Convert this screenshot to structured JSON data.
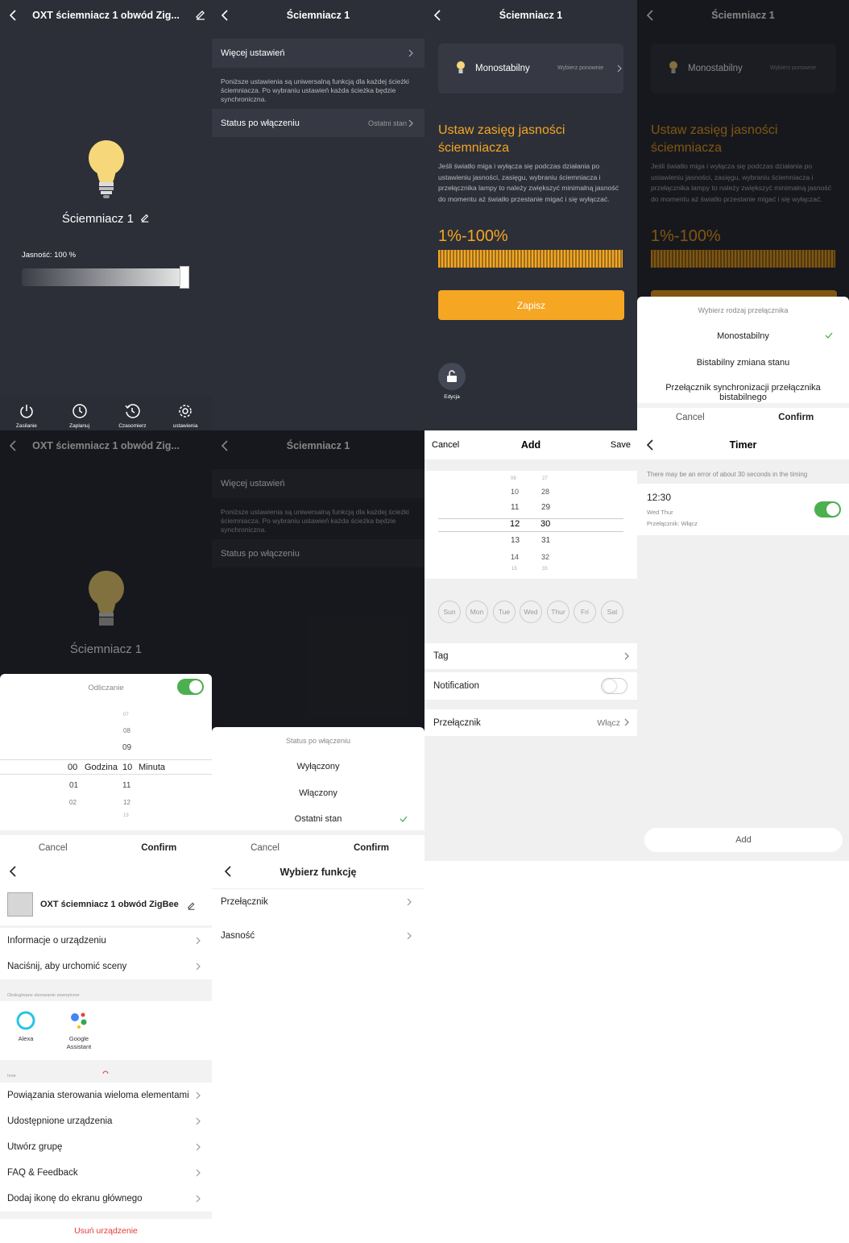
{
  "colors": {
    "dark_bg": "#2c2f38",
    "accent": "#f5a623",
    "green": "#4caf50",
    "red": "#e53935"
  },
  "p1": {
    "title": "OXT ściemniacz 1 obwód Zig...",
    "device_name": "Ściemniacz 1",
    "brightness_label": "Jasność: 100 %",
    "brightness": 1.0,
    "nav": [
      "Zasilanie",
      "Zaplanuj",
      "Czasomierz",
      "ustawienia"
    ]
  },
  "p2": {
    "title": "Ściemniacz 1",
    "more_settings": "Więcej ustawień",
    "desc": "Poniższe ustawienia są uniwersalną funkcją dla każdej ścieżki ściemniacza. Po wybraniu ustawień każda ścieżka będzie synchroniczna.",
    "status_label": "Status po włączeniu",
    "status_value": "Ostatni stan"
  },
  "p3": {
    "title": "Ściemniacz 1",
    "switch_type": "Monostabilny",
    "rechoose": "Wybierz ponownie",
    "heading": "Ustaw zasięg jasności ściemniacza",
    "body": "Jeśli światło miga i wyłącza się podczas działania po ustawieniu jasności, zasięgu, wybraniu ściemniacza i przełącznika lampy to należy zwiększyć minimalną jasność do momentu aż światło przestanie migać i się wyłączać.",
    "range": "1%-100%",
    "save": "Zapisz",
    "edit": "Edycja"
  },
  "p4": {
    "sheet_title": "Wybierz rodzaj przełącznika",
    "options": [
      "Monostabilny",
      "Bistabilny zmiana stanu",
      "Przełącznik synchronizacji przełącznika bistabilnego"
    ],
    "cancel": "Cancel",
    "confirm": "Confirm"
  },
  "p5": {
    "countdown": "Odliczanie",
    "hours": [
      "",
      "",
      "",
      "00",
      "01",
      "02",
      ""
    ],
    "minutes": [
      "07",
      "08",
      "09",
      "10",
      "11",
      "12",
      "13"
    ],
    "hour_unit": "Godzina",
    "minute_unit": "Minuta",
    "cancel": "Cancel",
    "confirm": "Confirm"
  },
  "p6": {
    "sheet_title": "Status po włączeniu",
    "options": [
      "Wyłączony",
      "Włączony",
      "Ostatni stan"
    ],
    "cancel": "Cancel",
    "confirm": "Confirm"
  },
  "p7": {
    "cancel": "Cancel",
    "title": "Add",
    "save": "Save",
    "hours": [
      "09",
      "10",
      "11",
      "12",
      "13",
      "14",
      "15"
    ],
    "minutes": [
      "27",
      "28",
      "29",
      "30",
      "31",
      "32",
      "33"
    ],
    "days": [
      "Sun",
      "Mon",
      "Tue",
      "Wed",
      "Thur",
      "Fri",
      "Sat"
    ],
    "tag": "Tag",
    "notification": "Notification",
    "switch_label": "Przełącznik",
    "switch_value": "Włącz"
  },
  "p8": {
    "title": "Timer",
    "note": "There may be an error of about 30 seconds in the timing",
    "time": "12:30",
    "days": "Wed Thur",
    "action": "Przełącznik: Włącz",
    "add": "Add"
  },
  "p9": {
    "device": "OXT ściemniacz 1 obwód ZigBee",
    "info": "Informacje o urządzeniu",
    "scene": "Naciśnij, aby urchomić sceny",
    "ext_label": "Obsługiwane sterowanie zewnętrzne",
    "alexa": "Alexa",
    "google": "Google Assistant",
    "other_label": "Inne",
    "items": [
      "Powiązania sterowania wieloma elementami",
      "Udostępnione urządzenia",
      "Utwórz grupę",
      "FAQ & Feedback",
      "Dodaj ikonę do ekranu głównego"
    ],
    "remove": "Usuń urządzenie"
  },
  "p10": {
    "title": "Wybierz funkcję",
    "items": [
      "Przełącznik",
      "Jasność"
    ]
  }
}
